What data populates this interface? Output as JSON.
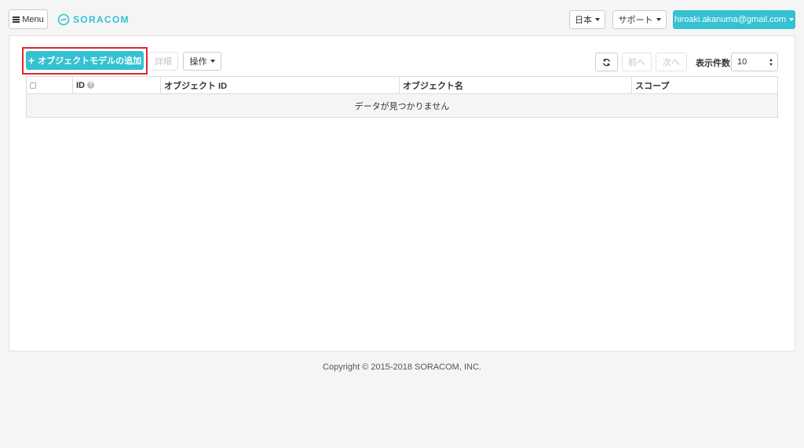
{
  "header": {
    "menu_label": "Menu",
    "logo_text": "SORACOM",
    "language_label": "日本",
    "support_label": "サポート",
    "user_email": "hiroaki.akanuma@gmail.com"
  },
  "toolbar": {
    "add_label": "オブジェクトモデルの追加",
    "detail_label": "詳細",
    "operations_label": "操作",
    "prev_label": "前へ",
    "next_label": "次へ",
    "per_page_label": "表示件数",
    "per_page_value": "10"
  },
  "table": {
    "columns": [
      "ID",
      "オブジェクト ID",
      "オブジェクト名",
      "スコープ"
    ],
    "empty_message": "データが見つかりません"
  },
  "footer": {
    "copyright": "Copyright © 2015-2018 SORACOM, INC."
  },
  "colors": {
    "accent": "#34c1d1",
    "highlight": "#e0262a"
  }
}
